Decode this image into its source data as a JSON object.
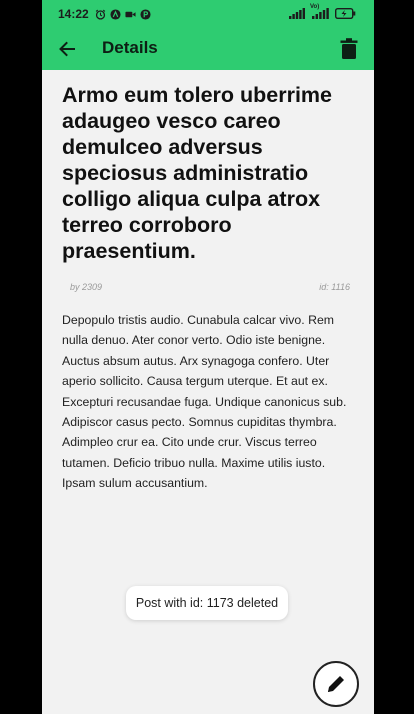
{
  "status_bar": {
    "time": "14:22",
    "network_label": "Vo)",
    "icons": [
      "alarm-icon",
      "a-app-icon",
      "video-camera-icon",
      "p-app-icon",
      "wifi-signal-icon",
      "cell-signal-icon",
      "battery-charging-icon"
    ]
  },
  "app_bar": {
    "title": "Details",
    "back_icon": "arrow-left-icon",
    "delete_icon": "trash-icon",
    "color": "#2ecc71"
  },
  "post": {
    "title": "Armo eum tolero uberrime adaugeo vesco careo demulceo adversus speciosus administratio colligo aliqua culpa atrox terreo corroboro praesentium.",
    "author": "by 2309",
    "id_label": "id: 1116",
    "body": "Depopulo tristis audio. Cunabula calcar vivo. Rem nulla denuo. Ater conor verto. Odio iste benigne. Auctus absum autus. Arx synagoga confero. Uter aperio sollicito. Causa tergum uterque. Et aut ex. Excepturi recusandae fuga. Undique canonicus sub. Adipiscor casus pecto. Somnus cupiditas thymbra. Adimpleo crur ea. Cito unde crur. Viscus terreo tutamen. Deficio tribuo nulla. Maxime utilis iusto. Ipsam sulum accusantium."
  },
  "toast": {
    "message": "Post with id: 1173 deleted"
  },
  "fab": {
    "icon": "pencil-icon"
  }
}
